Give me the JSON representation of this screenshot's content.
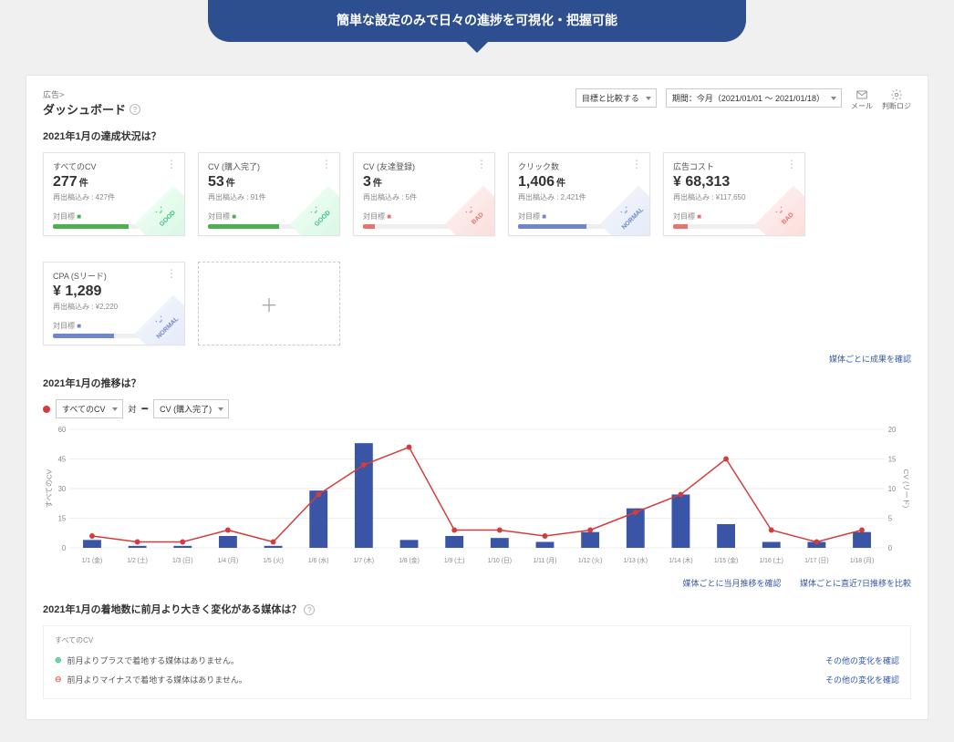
{
  "hero": "簡単な設定のみで日々の進捗を可視化・把握可能",
  "breadcrumb": "広告>",
  "page_title": "ダッシュボード",
  "compare_select": "目標と比較する",
  "period_select": "期間：今月（2021/01/01 ～ 2021/01/18）",
  "tool_mail": "メール",
  "tool_settings": "判断ロジ",
  "section_progress_title": "2021年1月の達成状況は？",
  "cards": [
    {
      "title": "すべてのCV",
      "value": "277",
      "unit": "件",
      "sub": "再出稿込み : 427件",
      "lbl": "対目標 ",
      "pct": 62,
      "color": "#4caf50",
      "status": "GOOD"
    },
    {
      "title": "CV (購入完了)",
      "value": "53",
      "unit": "件",
      "sub": "再出稿込み : 91件",
      "lbl": "対目標 ",
      "pct": 58,
      "color": "#4caf50",
      "status": "GOOD"
    },
    {
      "title": "CV (友達登録)",
      "value": "3",
      "unit": "件",
      "sub": "再出稿込み : 5件",
      "lbl": "対目標 ",
      "pct": 10,
      "color": "#e57373",
      "status": "BAD"
    },
    {
      "title": "クリック数",
      "value": "1,406",
      "unit": "件",
      "sub": "再出稿込み : 2,421件",
      "lbl": "対目標 ",
      "pct": 56,
      "color": "#6f87c9",
      "status": "NORMAL"
    },
    {
      "title": "広告コスト",
      "value": "¥ 68,313",
      "unit": "",
      "sub": "再出稿込み : ¥117,650",
      "lbl": "対目標 ",
      "pct": 12,
      "color": "#e57373",
      "status": "BAD"
    },
    {
      "title": "CPA (Sリード)",
      "value": "¥ 1,289",
      "unit": "",
      "sub": "再出稿込み : ¥2,220",
      "lbl": "対目標 ",
      "pct": 50,
      "color": "#6f87c9",
      "status": "NORMAL"
    }
  ],
  "link_media_result": "媒体ごとに成果を確認",
  "section_trend_title": "2021年1月の推移は？",
  "trend_select_left": "すべてのCV",
  "trend_join": "対",
  "trend_select_right": "CV (購入完了)",
  "chart_data": {
    "type": "line+bar",
    "y_left_label": "すべてのCV",
    "y_right_label": "CV (リード)",
    "y_left_ticks": [
      0,
      15,
      30,
      45,
      60
    ],
    "y_right_ticks": [
      0,
      5,
      10,
      15,
      20
    ],
    "categories": [
      "1/1 (金)",
      "1/2 (土)",
      "1/3 (日)",
      "1/4 (月)",
      "1/5 (火)",
      "1/6 (水)",
      "1/7 (木)",
      "1/8 (金)",
      "1/9 (土)",
      "1/10 (日)",
      "1/11 (月)",
      "1/12 (火)",
      "1/13 (水)",
      "1/14 (木)",
      "1/15 (金)",
      "1/16 (土)",
      "1/17 (日)",
      "1/18 (月)"
    ],
    "bars": [
      4,
      1,
      1,
      6,
      1,
      29,
      53,
      4,
      6,
      5,
      3,
      8,
      20,
      27,
      12,
      3,
      3,
      8
    ],
    "line": [
      2,
      1,
      1,
      3,
      1,
      9,
      14,
      17,
      3,
      3,
      2,
      3,
      6,
      9,
      15,
      3,
      1,
      3
    ]
  },
  "link_trend_media": "媒体ごとに当月推移を確認",
  "link_trend_7d": "媒体ごとに直近7日推移を比較",
  "section_change_title": "2021年1月の着地数に前月より大きく変化がある媒体は？",
  "change_sub": "すべてのCV",
  "change_plus_msg": "前月よりプラスで着地する媒体はありません。",
  "change_minus_msg": "前月よりマイナスで着地する媒体はありません。",
  "change_link": "その他の変化を確認"
}
